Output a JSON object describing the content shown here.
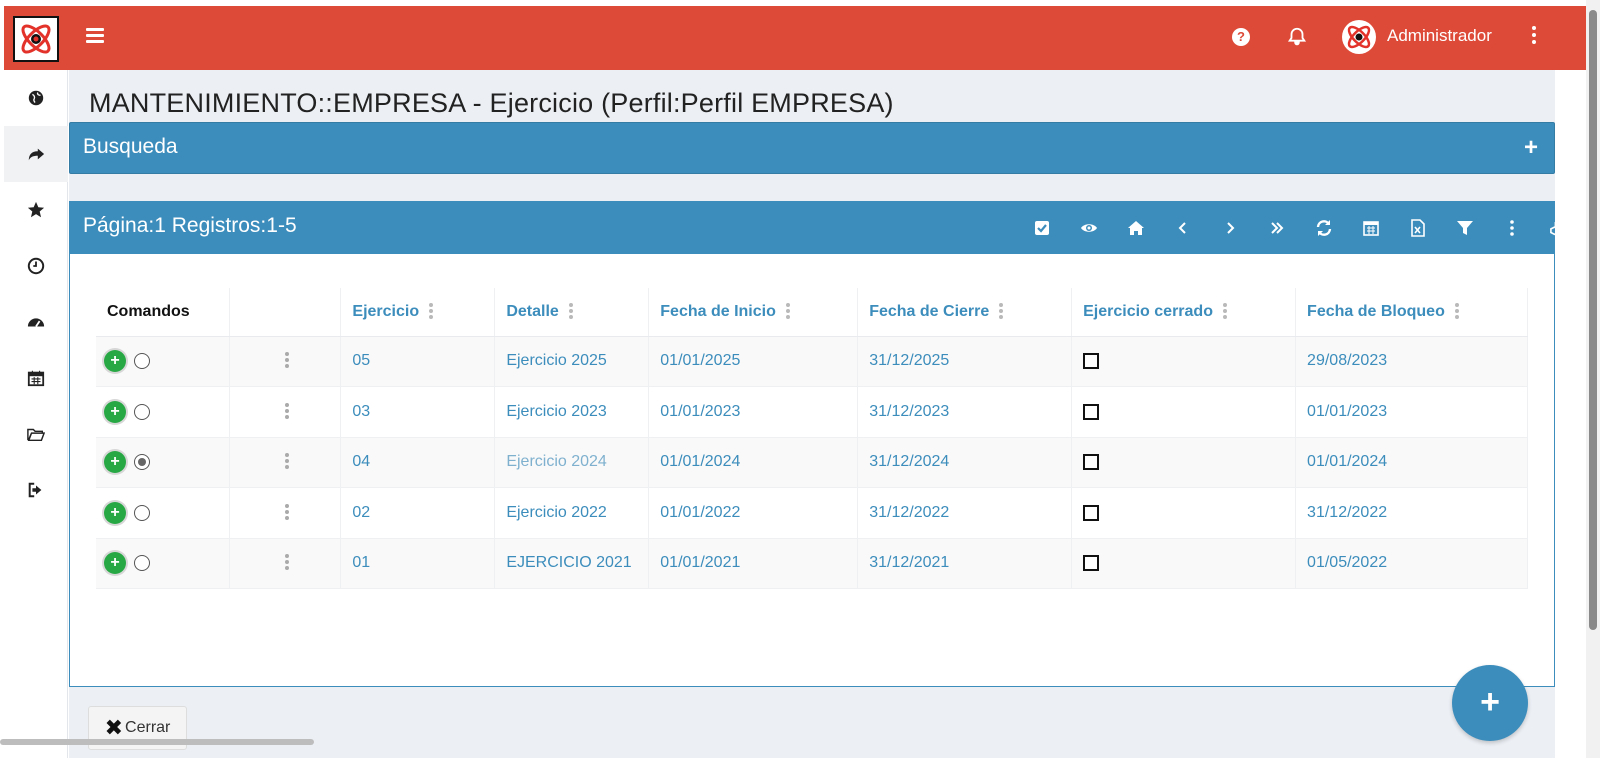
{
  "header": {
    "user_name": "Administrador",
    "help_icon": "question-circle-icon",
    "bell_icon": "bell-icon",
    "accent_color": "#dd4a38"
  },
  "sidebar": {
    "items": [
      {
        "icon": "globe-icon"
      },
      {
        "icon": "share-arrow-icon"
      },
      {
        "icon": "star-icon"
      },
      {
        "icon": "clock-icon"
      },
      {
        "icon": "dashboard-gauge-icon"
      },
      {
        "icon": "calendar-icon"
      },
      {
        "icon": "folder-open-icon"
      },
      {
        "icon": "sign-out-icon"
      }
    ]
  },
  "page": {
    "title": "MANTENIMIENTO::EMPRESA - Ejercicio (Perfil:Perfil EMPRESA)"
  },
  "search_panel": {
    "title": "Busqueda",
    "expand_label": "+"
  },
  "results_panel": {
    "title": "Página:1 Registros:1-5",
    "toolbar": [
      "check-square-icon",
      "eye-icon",
      "home-icon",
      "chevron-left-icon",
      "chevron-right-icon",
      "double-chevron-right-icon",
      "refresh-icon",
      "calendar-icon",
      "excel-file-icon",
      "filter-icon",
      "vertical-ellipsis-icon",
      "cubes-icon"
    ],
    "primary_color": "#3c8dbc"
  },
  "table": {
    "headers": {
      "comandos": "Comandos",
      "ejercicio": "Ejercicio",
      "detalle": "Detalle",
      "fecha_inicio": "Fecha de Inicio",
      "fecha_cierre": "Fecha de Cierre",
      "ejercicio_cerrado": "Ejercicio cerrado",
      "fecha_bloqueo": "Fecha de Bloqueo"
    },
    "rows": [
      {
        "ejercicio": "05",
        "detalle": "Ejercicio 2025",
        "fecha_inicio": "01/01/2025",
        "fecha_cierre": "31/12/2025",
        "cerrado": false,
        "fecha_bloqueo": "29/08/2023",
        "selected": false
      },
      {
        "ejercicio": "03",
        "detalle": "Ejercicio 2023",
        "fecha_inicio": "01/01/2023",
        "fecha_cierre": "31/12/2023",
        "cerrado": false,
        "fecha_bloqueo": "01/01/2023",
        "selected": false
      },
      {
        "ejercicio": "04",
        "detalle": "Ejercicio 2024",
        "fecha_inicio": "01/01/2024",
        "fecha_cierre": "31/12/2024",
        "cerrado": false,
        "fecha_bloqueo": "01/01/2024",
        "selected": true
      },
      {
        "ejercicio": "02",
        "detalle": "Ejercicio 2022",
        "fecha_inicio": "01/01/2022",
        "fecha_cierre": "31/12/2022",
        "cerrado": false,
        "fecha_bloqueo": "31/12/2022",
        "selected": false
      },
      {
        "ejercicio": "01",
        "detalle": "EJERCICIO 2021",
        "fecha_inicio": "01/01/2021",
        "fecha_cierre": "31/12/2021",
        "cerrado": false,
        "fecha_bloqueo": "01/05/2022",
        "selected": false
      }
    ]
  },
  "footer": {
    "close_label": "Cerrar",
    "fab_label": "+"
  }
}
